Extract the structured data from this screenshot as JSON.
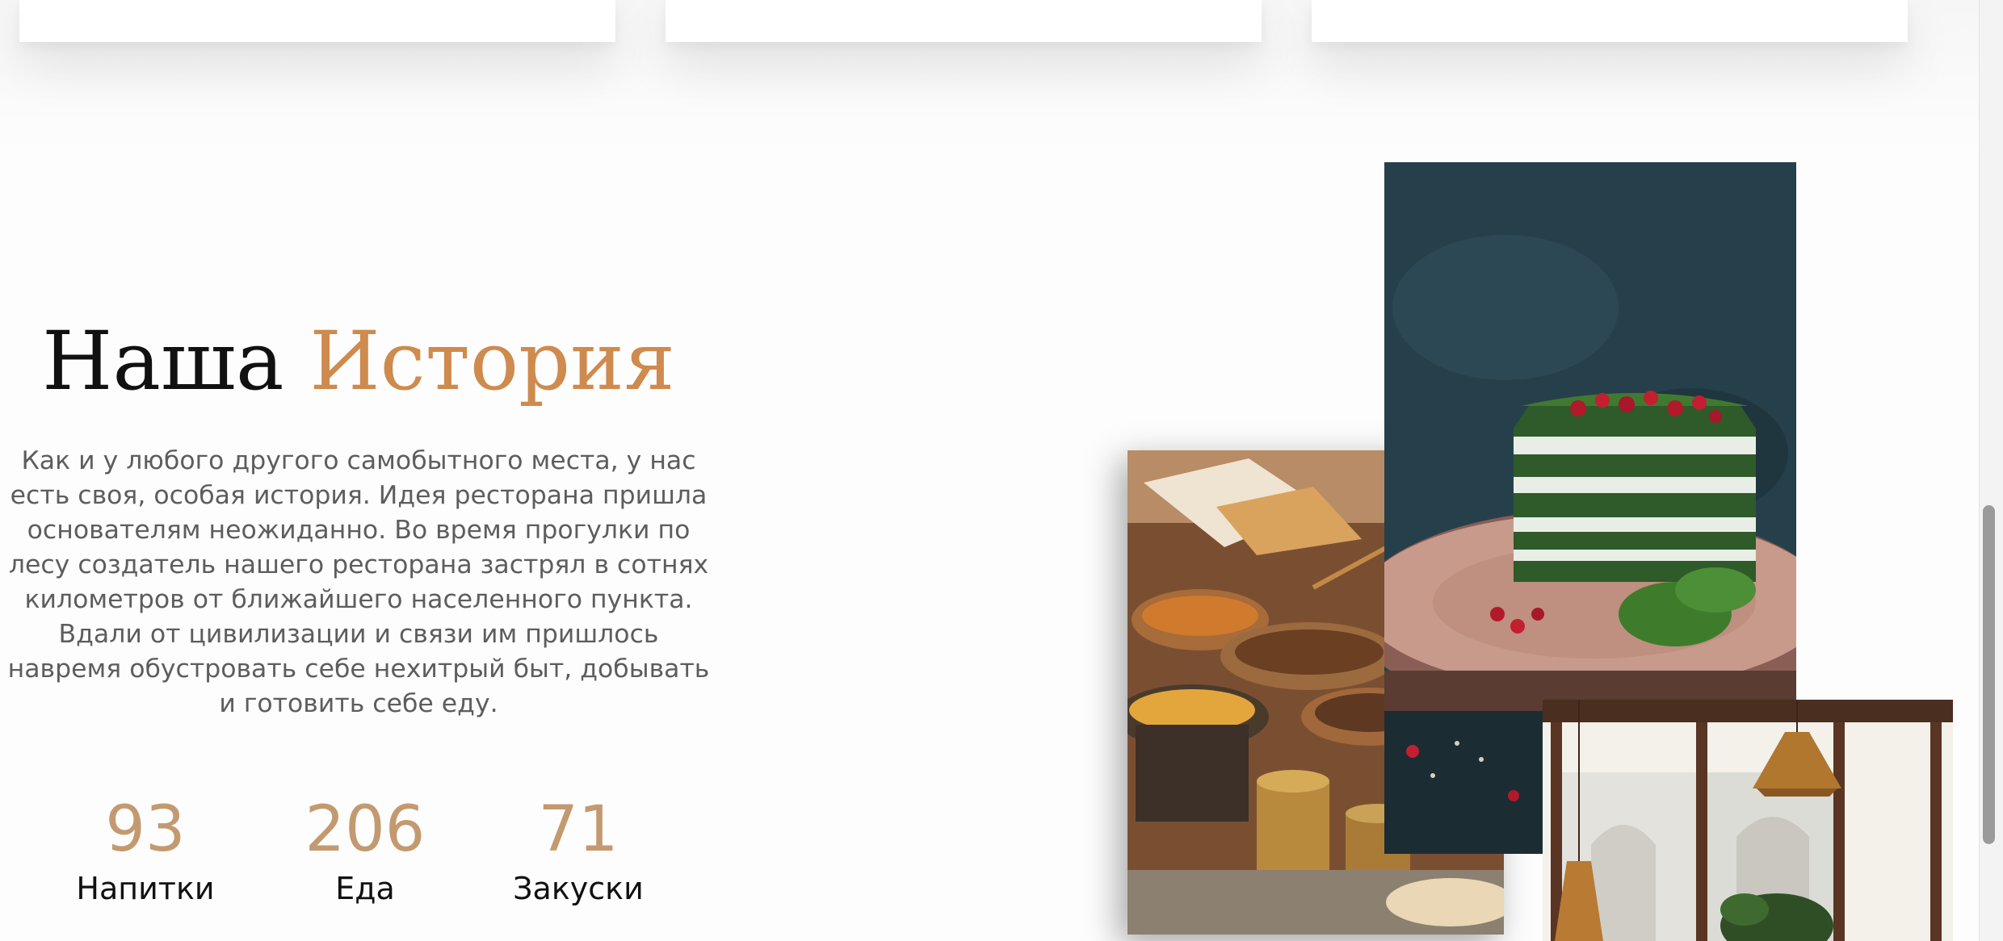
{
  "story": {
    "title_word1": "Наша",
    "title_word2": "История",
    "paragraph": "Как и у любого другого самобытного места, у нас есть своя, особая история. Идея ресторана пришла основателям неожиданно. Во время прогулки по лесу создатель нашего ресторана застрял в сотнях километров от ближайшего населенного пункта. Вдали от цивилизации и связи им пришлось навремя обустровать себе нехитрый быт, добывать и готовить себе еду."
  },
  "stats": [
    {
      "number": "93",
      "label": "Напитки"
    },
    {
      "number": "206",
      "label": "Еда"
    },
    {
      "number": "71",
      "label": "Закуски"
    }
  ],
  "colors": {
    "accent": "#cf8a4e",
    "stat_number": "#c39a70",
    "text": "#5d5d5d",
    "heading": "#111111"
  },
  "images": [
    "spices-photo",
    "green-cake-photo",
    "cafe-interior-photo"
  ]
}
